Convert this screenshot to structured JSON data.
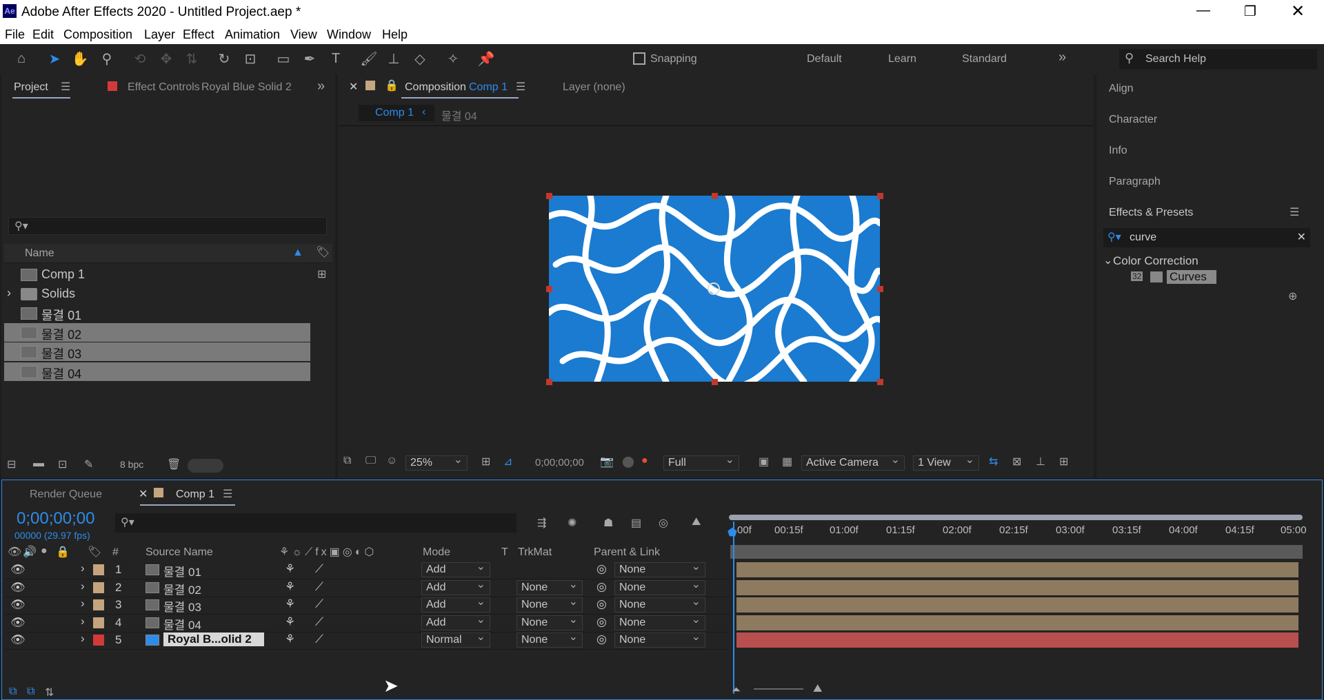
{
  "window": {
    "title": "Adobe After Effects 2020 - Untitled Project.aep *",
    "app_icon": "Ae"
  },
  "menu": [
    "File",
    "Edit",
    "Composition",
    "Layer",
    "Effect",
    "Animation",
    "View",
    "Window",
    "Help"
  ],
  "toolbar": {
    "snapping": "Snapping",
    "workspaces": [
      "Default",
      "Learn",
      "Standard"
    ],
    "search_placeholder": "Search Help"
  },
  "project": {
    "tab": "Project",
    "effect_controls": "Effect Controls",
    "effect_layer": "Royal Blue Solid 2",
    "column_name": "Name",
    "bpc": "8 bpc",
    "items": [
      {
        "name": "Comp 1"
      },
      {
        "name": "Solids"
      },
      {
        "name": "물결 01"
      },
      {
        "name": "물결 02"
      },
      {
        "name": "물결 03"
      },
      {
        "name": "물결 04"
      }
    ]
  },
  "composition": {
    "tab_prefix": "Composition",
    "tab_name": "Comp 1",
    "layer_tab": "Layer (none)",
    "breadcrumb_current": "Comp 1",
    "breadcrumb_next": "물결 04",
    "zoom": "25%",
    "timecode": "0;00;00;00",
    "resolution": "Full",
    "camera": "Active Camera",
    "views": "1 View"
  },
  "right_panels": {
    "items": [
      "Align",
      "Character",
      "Info",
      "Paragraph"
    ],
    "effects_title": "Effects & Presets",
    "search_value": "curve",
    "category": "Color Correction",
    "effect": "Curves"
  },
  "timeline": {
    "render_queue": "Render Queue",
    "comp_tab": "Comp 1",
    "timecode": "0;00;00;00",
    "fps": "00000 (29.97 fps)",
    "columns": {
      "num": "#",
      "source": "Source Name",
      "mode": "Mode",
      "t": "T",
      "trkmat": "TrkMat",
      "parent": "Parent & Link"
    },
    "ruler": [
      "00f",
      "00:15f",
      "01:00f",
      "01:15f",
      "02:00f",
      "02:15f",
      "03:00f",
      "03:15f",
      "04:00f",
      "04:15f",
      "05:00"
    ],
    "layers": [
      {
        "num": "1",
        "name": "물결 01",
        "mode": "Add",
        "trkmat": "",
        "parent": "None",
        "color": "#c4a57f"
      },
      {
        "num": "2",
        "name": "물결 02",
        "mode": "Add",
        "trkmat": "None",
        "parent": "None",
        "color": "#c4a57f"
      },
      {
        "num": "3",
        "name": "물결 03",
        "mode": "Add",
        "trkmat": "None",
        "parent": "None",
        "color": "#c4a57f"
      },
      {
        "num": "4",
        "name": "물결 04",
        "mode": "Add",
        "trkmat": "None",
        "parent": "None",
        "color": "#c4a57f"
      },
      {
        "num": "5",
        "name": "Royal B...olid 2",
        "mode": "Normal",
        "trkmat": "None",
        "parent": "None",
        "color": "#d23a3a"
      }
    ]
  }
}
